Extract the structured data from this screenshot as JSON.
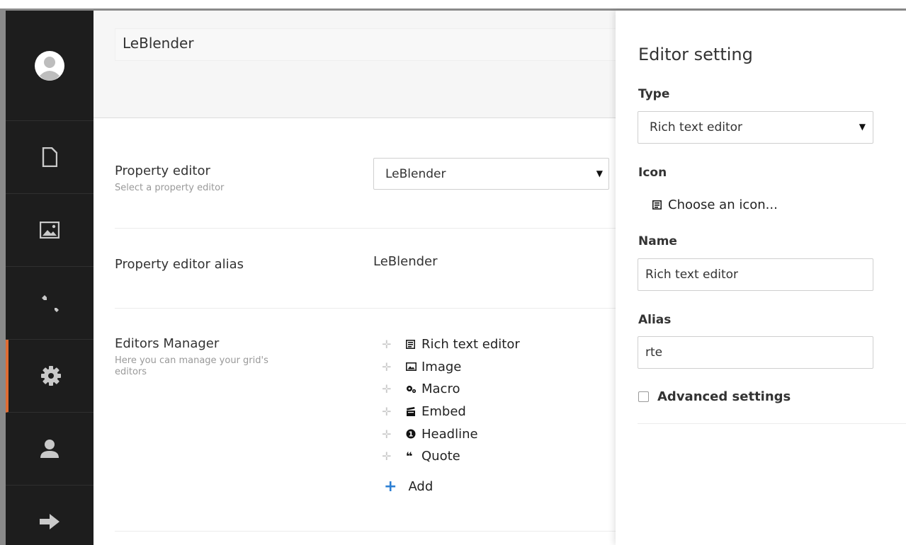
{
  "header": {
    "name_value": "LeBlender"
  },
  "sidebar": {
    "items": [
      {
        "icon": "document-icon"
      },
      {
        "icon": "image-icon"
      },
      {
        "icon": "wrench-icon"
      },
      {
        "icon": "gear-icon",
        "active": true
      },
      {
        "icon": "user-icon"
      },
      {
        "icon": "arrow-right-icon"
      }
    ],
    "accent": "#e06d34"
  },
  "main": {
    "property_editor": {
      "label": "Property editor",
      "description": "Select a property editor",
      "selected": "LeBlender"
    },
    "property_editor_alias": {
      "label": "Property editor alias",
      "value": "LeBlender"
    },
    "editors_manager": {
      "label": "Editors Manager",
      "description": "Here you can manage your grid's editors",
      "editors": [
        {
          "icon": "rte-icon",
          "label": "Rich text editor"
        },
        {
          "icon": "image-icon",
          "label": "Image"
        },
        {
          "icon": "macro-icon",
          "label": "Macro"
        },
        {
          "icon": "embed-icon",
          "label": "Embed"
        },
        {
          "icon": "headline-icon",
          "label": "Headline"
        },
        {
          "icon": "quote-icon",
          "label": "Quote"
        }
      ],
      "add_label": "Add"
    }
  },
  "panel": {
    "title": "Editor setting",
    "type_label": "Type",
    "type_selected": "Rich text editor",
    "icon_label": "Icon",
    "choose_icon_label": "Choose an icon...",
    "name_label": "Name",
    "name_value": "Rich text editor",
    "alias_label": "Alias",
    "alias_value": "rte",
    "advanced_label": "Advanced settings"
  }
}
